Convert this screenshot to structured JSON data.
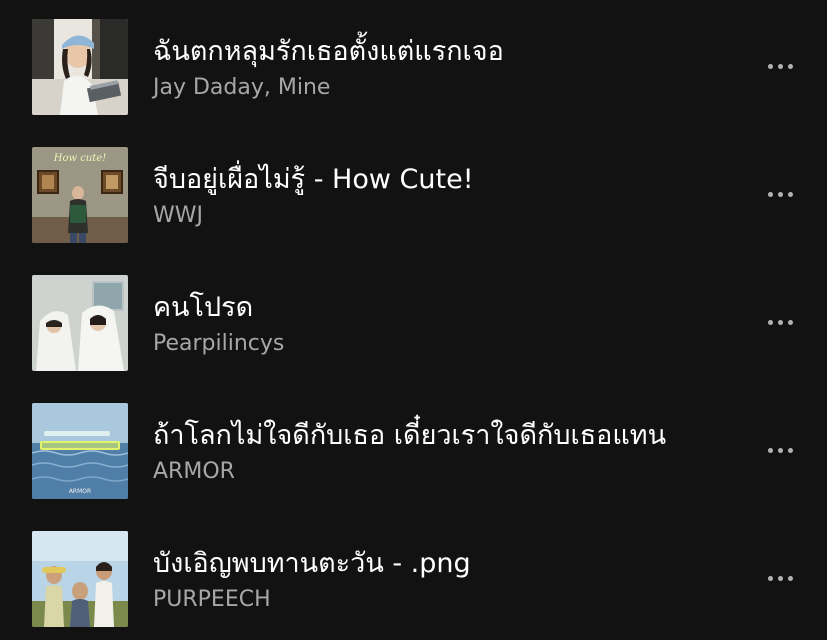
{
  "tracks": [
    {
      "title": "ฉันตกหลุมรักเธอตั้งแต่แรกเจอ",
      "artist": "Jay Daday, Mine",
      "art_icon": "album-art-girl-at-keyboard",
      "more_icon": "more-options-icon"
    },
    {
      "title": "จีบอยู่เผื่อไม่รู้ - How Cute!",
      "artist": "WWJ",
      "art_icon": "album-art-museum-gallery",
      "art_text": "How cute!",
      "more_icon": "more-options-icon"
    },
    {
      "title": "คนโปรด",
      "artist": "Pearpilincys",
      "art_icon": "album-art-two-people-under-sheets",
      "more_icon": "more-options-icon"
    },
    {
      "title": "ถ้าโลกไม่ใจดีกับเธอ เดี๋ยวเราใจดีกับเธอแทน",
      "artist": "ARMOR",
      "art_icon": "album-art-sea",
      "art_text": "ARMOR",
      "more_icon": "more-options-icon"
    },
    {
      "title": "บังเอิญพบทานตะวัน - .png",
      "artist": "PURPEECH",
      "art_icon": "album-art-band-photo",
      "more_icon": "more-options-icon"
    }
  ],
  "colors": {
    "background": "#121212",
    "title": "#ffffff",
    "artist": "#a7a7a7",
    "more_dots": "#b3b3b3"
  }
}
